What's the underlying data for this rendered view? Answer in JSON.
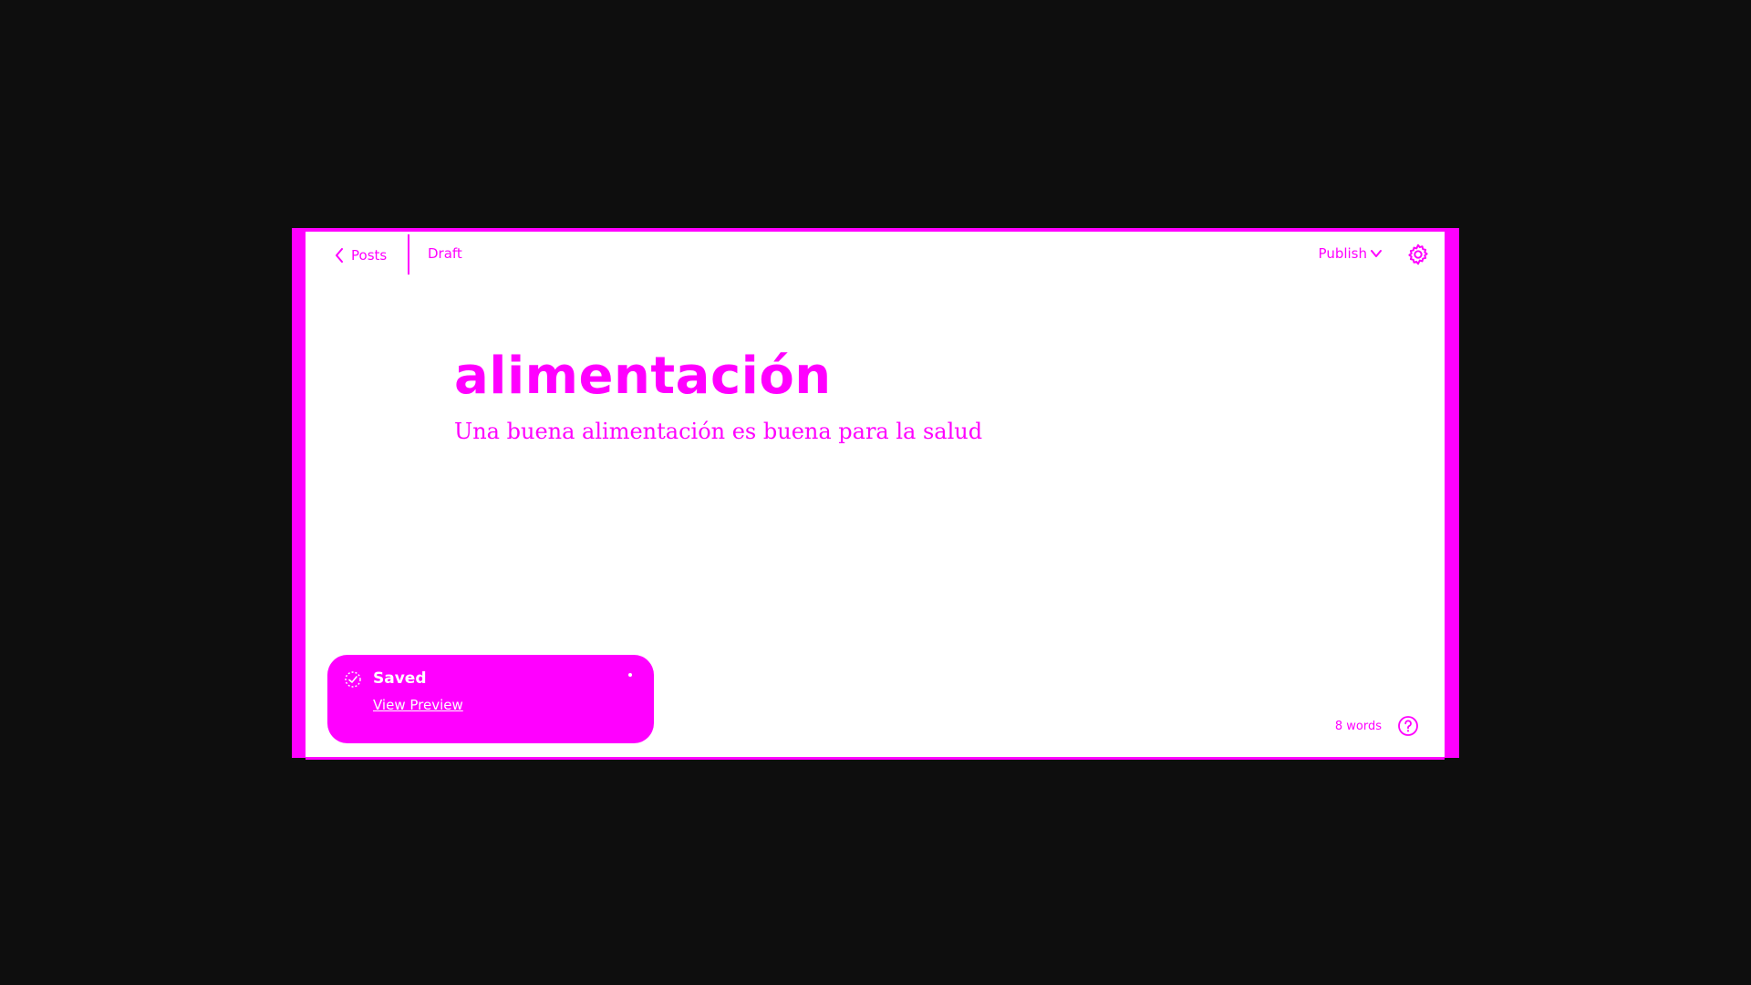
{
  "topbar": {
    "back_label": "Posts",
    "status": "Draft",
    "publish_label": "Publish"
  },
  "post": {
    "title": "alimentación",
    "body": "Una buena alimentación es buena para la salud"
  },
  "toast": {
    "title": "Saved",
    "link_label": "View Preview"
  },
  "footer": {
    "word_count": "8 words"
  },
  "icons": {
    "back": "chevron-left-icon",
    "publish_dropdown": "chevron-down-icon",
    "settings": "gear-icon",
    "saved": "check-icon",
    "help": "question-circle-icon"
  },
  "colors": {
    "accent": "#ff00ff",
    "background": "#0e0e0e",
    "editor_bg": "#ffffff"
  }
}
